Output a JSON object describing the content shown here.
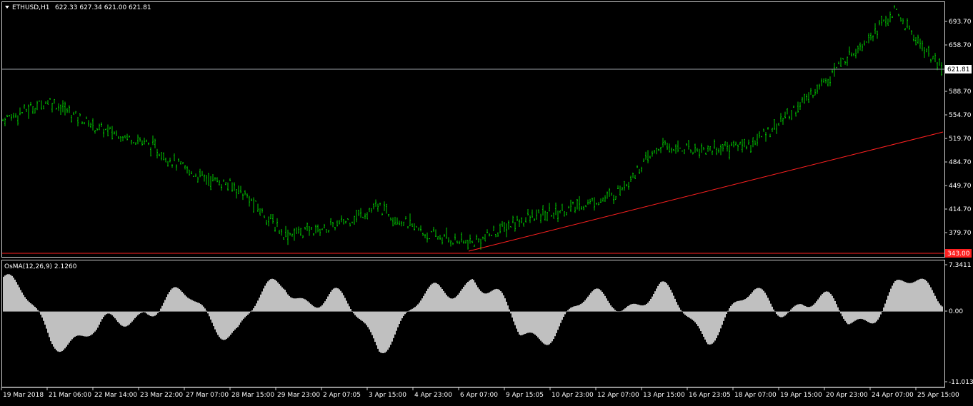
{
  "header": {
    "symbol": "ETHUSD,H1",
    "ohlc": "622.33 627.34 621.00 621.81"
  },
  "price_axis": {
    "labels": [
      "693.70",
      "658.70",
      "621.81",
      "588.70",
      "554.70",
      "519.70",
      "484.70",
      "449.70",
      "414.70",
      "379.70",
      "343.00"
    ]
  },
  "current_price": {
    "value": "621.81"
  },
  "support_level": {
    "value": "343.00",
    "color": "#ff2020"
  },
  "indicator": {
    "title": "OsMA(12,26,9) 2.1260",
    "labels": [
      "7.3411",
      "0.00",
      "-11.0139"
    ],
    "fill_color": "#c0c0c0"
  },
  "time_axis": {
    "labels": [
      "19 Mar 2018",
      "21 Mar 06:00",
      "22 Mar 14:00",
      "23 Mar 22:00",
      "27 Mar 07:00",
      "28 Mar 15:00",
      "29 Mar 23:00",
      "2 Apr 07:05",
      "3 Apr 15:00",
      "4 Apr 23:00",
      "6 Apr 07:00",
      "9 Apr 15:05",
      "10 Apr 23:00",
      "12 Apr 07:00",
      "13 Apr 15:00",
      "16 Apr 23:05",
      "18 Apr 07:00",
      "19 Apr 15:00",
      "20 Apr 23:00",
      "24 Apr 07:00",
      "25 Apr 15:00"
    ]
  },
  "chart_data": [
    {
      "type": "bar",
      "subtype": "ohlc",
      "symbol": "ETHUSD",
      "timeframe": "H1",
      "x": [
        "19 Mar 2018",
        "21 Mar 06:00",
        "22 Mar 14:00",
        "23 Mar 22:00",
        "27 Mar 07:00",
        "28 Mar 15:00",
        "29 Mar 23:00",
        "2 Apr 07:05",
        "3 Apr 15:00",
        "4 Apr 23:00",
        "6 Apr 07:00",
        "9 Apr 15:05",
        "10 Apr 23:00",
        "12 Apr 07:00",
        "13 Apr 15:00",
        "16 Apr 23:05",
        "18 Apr 07:00",
        "19 Apr 15:00",
        "20 Apr 23:00",
        "24 Apr 07:00",
        "25 Apr 15:00"
      ],
      "values": [
        540,
        568,
        528,
        508,
        462,
        440,
        372,
        382,
        412,
        372,
        358,
        392,
        408,
        428,
        500,
        496,
        506,
        562,
        632,
        698,
        612
      ],
      "ylim": [
        343.0,
        711.0
      ],
      "bar_color": "#00c800",
      "lines": [
        {
          "label": "current price",
          "value": 621.81,
          "color": "#9aa0a6"
        },
        {
          "label": "support",
          "value": 343.0,
          "color": "#ff2020"
        }
      ],
      "trendline": {
        "color": "#ff2020",
        "from": {
          "x": "6 Apr 07:00",
          "y": 352
        },
        "to": {
          "x": "25 Apr 15:00",
          "y": 529
        }
      }
    },
    {
      "type": "area",
      "title": "OsMA(12,26,9) 2.1260",
      "x": [
        "19 Mar 2018",
        "21 Mar 06:00",
        "22 Mar 14:00",
        "23 Mar 22:00",
        "27 Mar 07:00",
        "28 Mar 15:00",
        "29 Mar 23:00",
        "2 Apr 07:05",
        "3 Apr 15:00",
        "4 Apr 23:00",
        "6 Apr 07:00",
        "9 Apr 15:05",
        "10 Apr 23:00",
        "12 Apr 07:00",
        "13 Apr 15:00",
        "16 Apr 23:05",
        "18 Apr 07:00",
        "19 Apr 15:00",
        "20 Apr 23:00",
        "24 Apr 07:00",
        "25 Apr 15:00"
      ],
      "values": [
        4.5,
        -3.0,
        -4.5,
        1.5,
        1.0,
        -2.5,
        4.5,
        1.5,
        -4.0,
        1.0,
        6.5,
        -4.0,
        -1.0,
        2.5,
        2.0,
        -2.5,
        1.5,
        2.0,
        -1.5,
        3.0,
        3.5
      ],
      "ylim": [
        -11.0139,
        7.3411
      ],
      "fill": "#c0c0c0"
    }
  ]
}
